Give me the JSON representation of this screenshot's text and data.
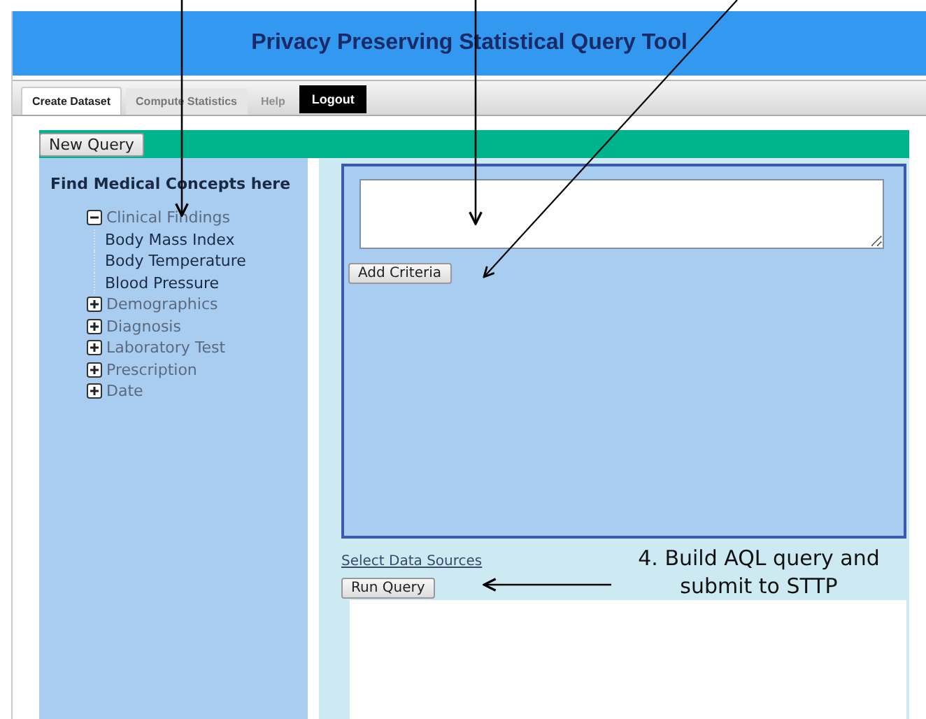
{
  "header": {
    "title": "Privacy Preserving Statistical Query Tool"
  },
  "tabs": [
    {
      "label": "Create Dataset",
      "selected": true,
      "disabled": false
    },
    {
      "label": "Compute Statistics",
      "selected": false,
      "disabled": false
    },
    {
      "label": "Help",
      "selected": false,
      "disabled": true
    }
  ],
  "logout_button": "Logout",
  "new_query_button": "New Query",
  "concepts": {
    "heading": "Find Medical Concepts here",
    "tree": [
      {
        "label": "Clinical Findings",
        "expanded": true,
        "children": [
          {
            "label": "Body Mass Index"
          },
          {
            "label": "Body Temperature"
          },
          {
            "label": "Blood Pressure"
          }
        ]
      },
      {
        "label": "Demographics",
        "expanded": false
      },
      {
        "label": "Diagnosis",
        "expanded": false
      },
      {
        "label": "Laboratory Test",
        "expanded": false
      },
      {
        "label": "Prescription",
        "expanded": false
      },
      {
        "label": "Date",
        "expanded": false
      }
    ]
  },
  "query": {
    "add_criteria_button": "Add Criteria",
    "data_sources_link": "Select Data Sources",
    "run_query_button": "Run Query"
  },
  "annotation": "4. Build AQL query and submit to STTP"
}
